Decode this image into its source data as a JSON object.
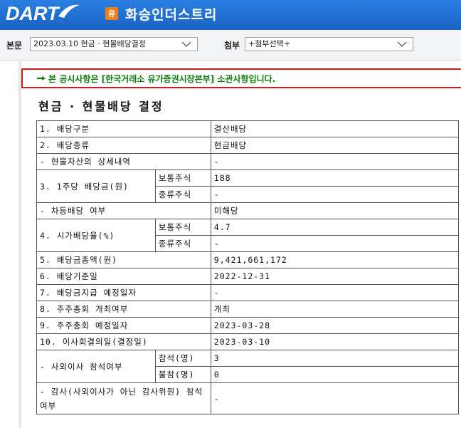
{
  "header": {
    "logo_text": "DART",
    "company_badge": "유",
    "company_name": "화승인더스트리",
    "brand_color": "#1a63c4",
    "badge_color": "#ef7d1a"
  },
  "toolbar": {
    "doc_label": "본문",
    "doc_select_value": "2023.03.10  현금 · 현물배당결정",
    "attach_label": "첨부",
    "attach_select_value": "+첨부선택+"
  },
  "notice": {
    "icon": "hand-pointer-icon",
    "text": "본 공시사항은 [한국거래소 유가증권시장본부] 소관사항입니다.",
    "border_color": "#c41f1f",
    "text_color": "#0a7a0a"
  },
  "document": {
    "title": "현금 · 현물배당 결정",
    "rows": {
      "r1": {
        "label": "1. 배당구분",
        "value": "결산배당"
      },
      "r2": {
        "label": "2. 배당종류",
        "value": "현금배당"
      },
      "r3": {
        "label": "- 현물자산의 상세내역",
        "value": "-"
      },
      "r4": {
        "label": "3. 1주당 배당금(원)",
        "sub1": "보통주식",
        "val1": "188",
        "sub2": "종류주식",
        "val2": "-"
      },
      "r5": {
        "label": "- 차등배당 여부",
        "value": "미해당"
      },
      "r6": {
        "label": "4. 시가배당율(%)",
        "sub1": "보통주식",
        "val1": "4.7",
        "sub2": "종류주식",
        "val2": "-"
      },
      "r7": {
        "label": "5. 배당금총액(원)",
        "value": "9,421,661,172"
      },
      "r8": {
        "label": "6. 배당기준일",
        "value": "2022-12-31"
      },
      "r9": {
        "label": "7. 배당금지급 예정일자",
        "value": "-"
      },
      "r10": {
        "label": "8. 주주총회 개최여부",
        "value": "개최"
      },
      "r11": {
        "label": "9. 주주총회 예정일자",
        "value": "2023-03-28"
      },
      "r12": {
        "label": "10. 이사회결의일(결정일)",
        "value": "2023-03-10"
      },
      "r13": {
        "label": "- 사외이사 참석여부",
        "sub1": "참석(명)",
        "val1": "3",
        "sub2": "불참(명)",
        "val2": "0"
      },
      "r14": {
        "label": "- 감사(사외이사가 아닌 감사위원) 참석여부",
        "value": "-"
      }
    }
  }
}
